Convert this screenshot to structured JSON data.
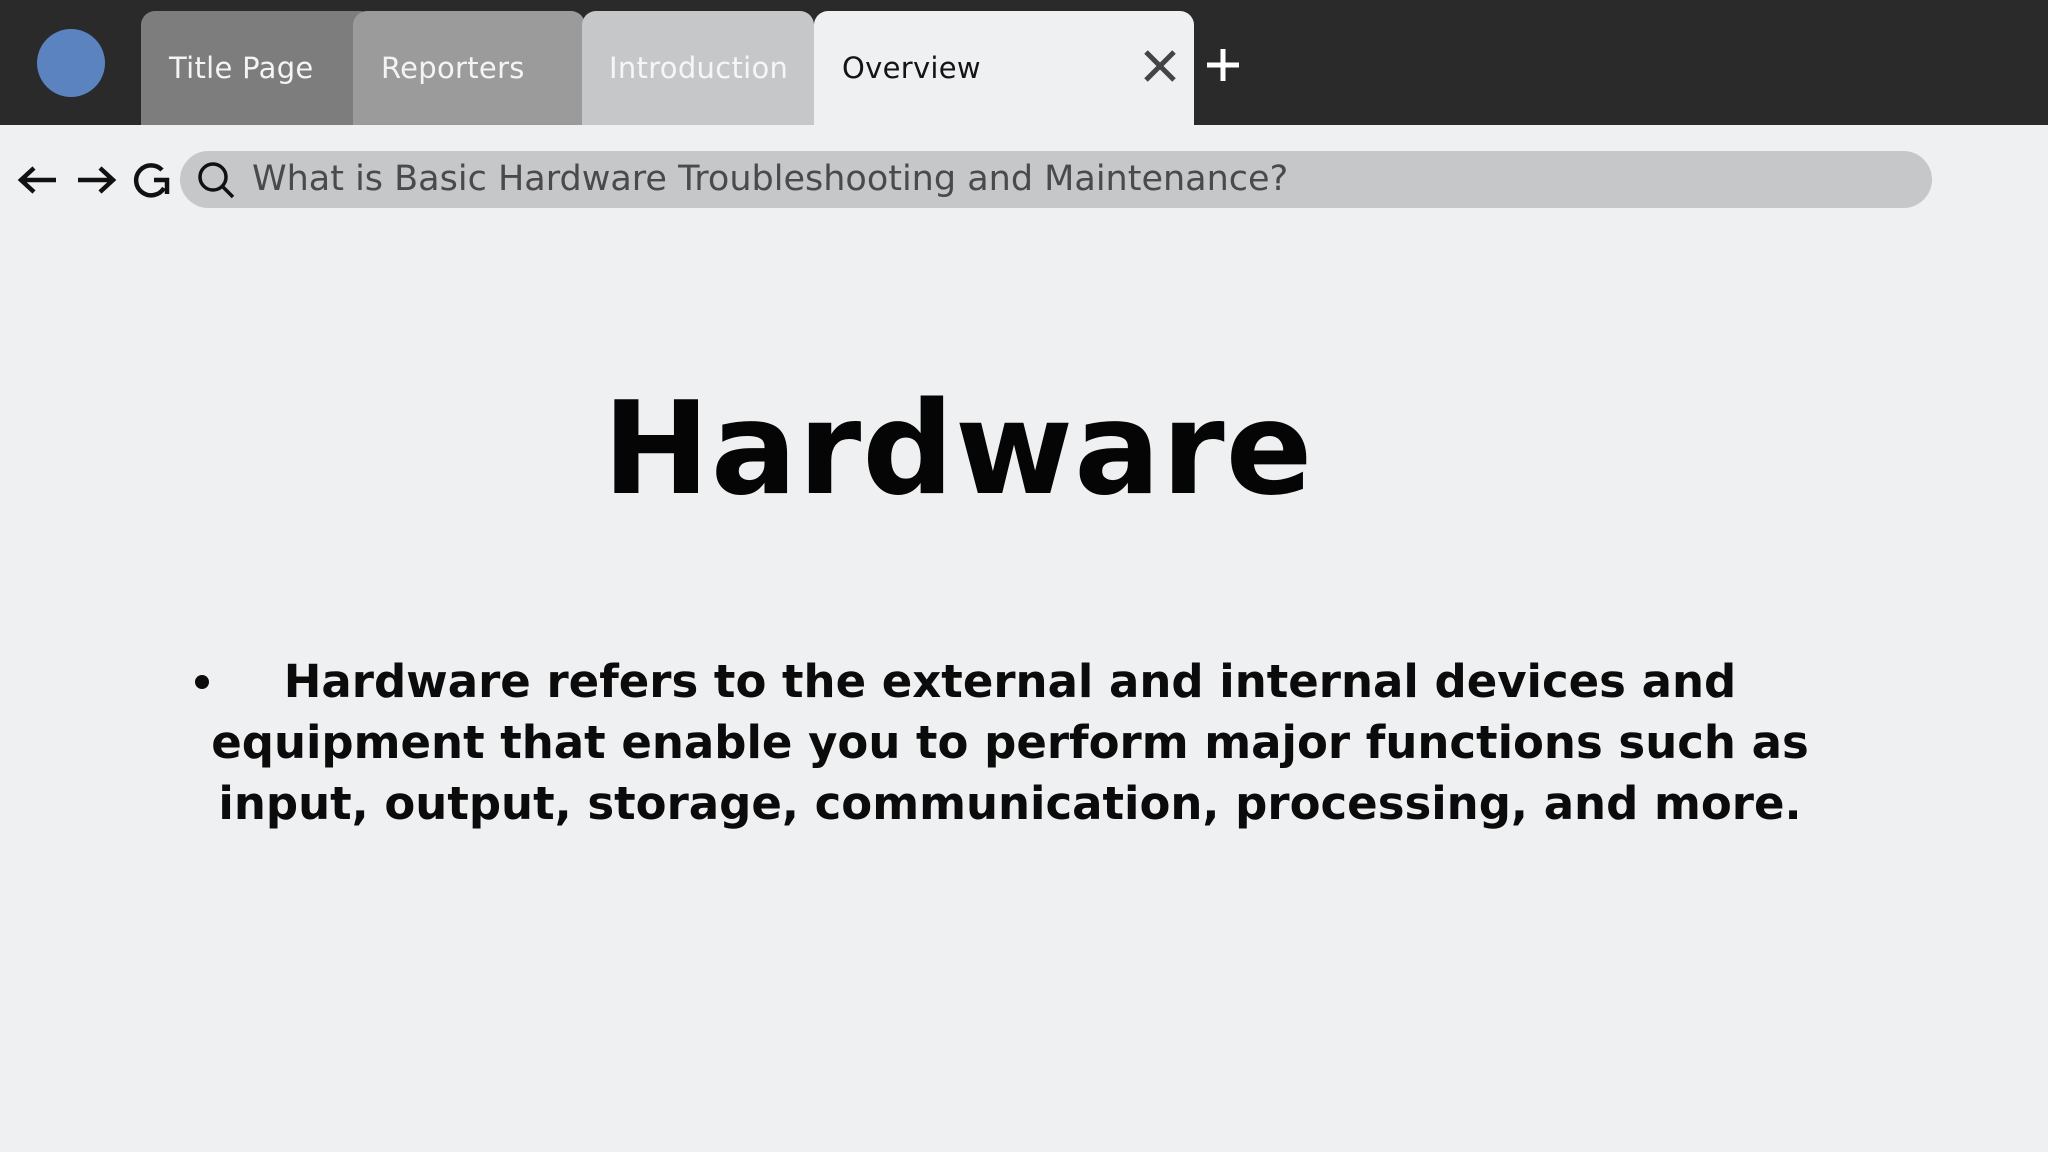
{
  "browser": {
    "tabs": [
      {
        "label": "Title Page"
      },
      {
        "label": "Reporters"
      },
      {
        "label": "Introduction"
      },
      {
        "label": "Overview",
        "active": true
      }
    ],
    "address_bar": {
      "query": "What is Basic Hardware Troubleshooting and Maintenance?"
    }
  },
  "slide": {
    "heading": "Hardware",
    "bullet": "Hardware refers to the external and internal devices and equipment that enable you to perform major functions such as input, output, storage, communication, processing, and more."
  },
  "colors": {
    "topbar": "#2a2a2a",
    "avatar": "#5b83c0",
    "page_background": "#eff0f2",
    "searchbar": "#c6c7c9"
  },
  "icons": {
    "back": "arrow-left",
    "forward": "arrow-right",
    "reload": "refresh",
    "search": "magnifier",
    "close": "x",
    "add": "plus"
  }
}
